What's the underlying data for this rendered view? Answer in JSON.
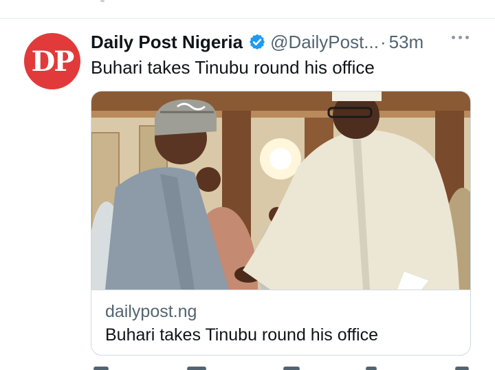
{
  "post": {
    "avatar_text": "DP",
    "display_name": "Daily Post Nigeria",
    "handle": "@DailyPost...",
    "separator": "·",
    "time": "53m",
    "text": "Buhari takes Tinubu round his office"
  },
  "card": {
    "domain": "dailypost.ng",
    "title": "Buhari takes Tinubu round his office"
  },
  "colors": {
    "avatar_bg": "#e23a3a",
    "verified": "#1d9bf0",
    "text_primary": "#0f1419",
    "text_secondary": "#536471",
    "border": "#cfd9de"
  },
  "icons": {
    "verified": "verified-badge-icon",
    "more": "more-options-icon"
  }
}
